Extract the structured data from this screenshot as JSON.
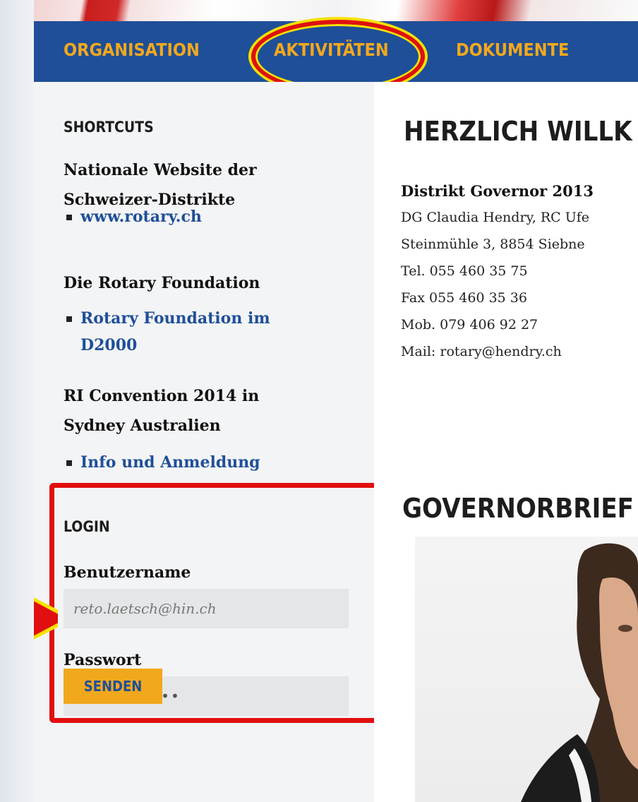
{
  "nav": {
    "items": [
      "ORGANISATION",
      "AKTIVITÄTEN",
      "DOKUMENTE"
    ],
    "highlight_color": "#e10f0f",
    "highlight_rim": "#f7e100"
  },
  "sidebar": {
    "heading": "SHORTCUTS",
    "sections": [
      {
        "label_lines": [
          "Nationale Website der",
          "Schweizer-Distrikte"
        ],
        "links": [
          [
            "www.rotary.ch"
          ]
        ]
      },
      {
        "label_lines": [
          "Die Rotary Foundation"
        ],
        "links": [
          [
            "Rotary Foundation im",
            "D2000"
          ]
        ]
      },
      {
        "label_lines": [
          "RI Convention 2014 in",
          "Sydney Australien"
        ],
        "links": [
          [
            "Info und Anmeldung"
          ]
        ]
      }
    ]
  },
  "login": {
    "heading": "LOGIN",
    "username_label": "Benutzername",
    "username_value": "reto.laetsch@hin.ch",
    "password_label": "Passwort",
    "password_value": "•••••••••••",
    "submit_label": "SENDEN"
  },
  "main": {
    "welcome_heading": "HERZLICH WILLK",
    "governor_title": "Distrikt Governor 2013",
    "contact_lines": [
      "DG Claudia Hendry, RC Ufe",
      "Steinmühle 3, 8854 Siebne",
      "Tel. 055 460 35 75",
      "Fax 055 460 35 36",
      "Mob. 079 406 92 27",
      "Mail: rotary@hendry.ch"
    ],
    "letters_heading": "GOVERNORBRIEF"
  },
  "colors": {
    "nav_bg": "#1f4f98",
    "nav_text": "#f2a81d",
    "link": "#1f4f98",
    "annotation_red": "#e10f0f"
  },
  "icons": [
    "list-bullet-icon",
    "annotation-arrow-icon"
  ]
}
